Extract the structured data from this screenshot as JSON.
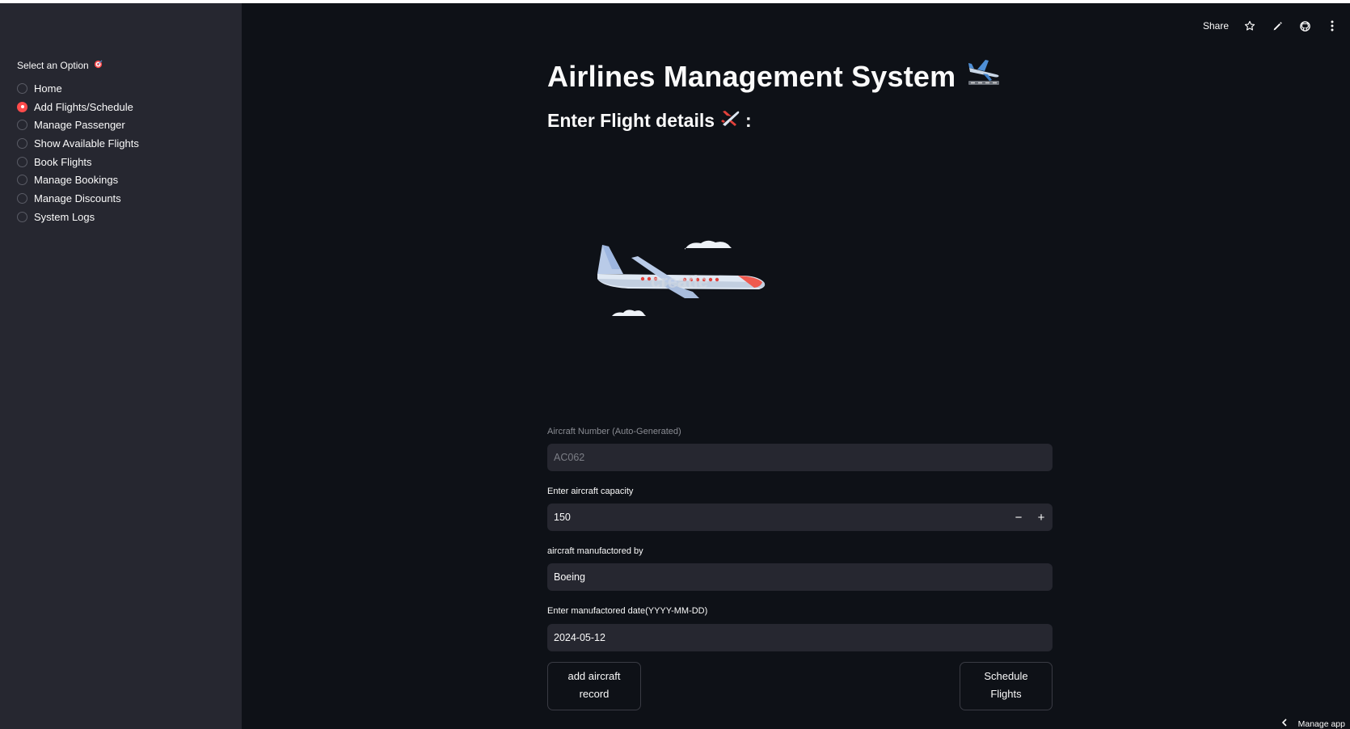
{
  "sidebar": {
    "label": "Select an Option",
    "label_icon": "target-icon",
    "options": [
      {
        "label": "Home",
        "selected": false
      },
      {
        "label": "Add Flights/Schedule",
        "selected": true
      },
      {
        "label": "Manage Passenger",
        "selected": false
      },
      {
        "label": "Show Available Flights",
        "selected": false
      },
      {
        "label": "Book Flights",
        "selected": false
      },
      {
        "label": "Manage Bookings",
        "selected": false
      },
      {
        "label": "Manage Discounts",
        "selected": false
      },
      {
        "label": "System Logs",
        "selected": false
      }
    ]
  },
  "toolbar": {
    "share_label": "Share",
    "icons": [
      "star-icon",
      "pencil-icon",
      "github-icon",
      "more-vertical-icon"
    ]
  },
  "main": {
    "title": "Airlines Management System",
    "title_icon": "airplane-emoji-icon",
    "subtitle": "Enter Flight details",
    "subtitle_icon": "airplane-small-emoji-icon",
    "subtitle_suffix": ":",
    "illustration_icon": "airplane-illustration-icon"
  },
  "form": {
    "aircraft_number_label": "Aircraft Number (Auto-Generated)",
    "aircraft_number_value": "AC062",
    "capacity_label": "Enter aircraft capacity",
    "capacity_value": "150",
    "stepper_minus": "−",
    "stepper_plus": "+",
    "manufacturer_label": "aircraft manufactored by",
    "manufacturer_value": "Boeing",
    "date_label": "Enter manufactored date(YYYY-MM-DD)",
    "date_value": "2024-05-12",
    "add_button_line1": "add aircraft",
    "add_button_line2": "record",
    "schedule_button_line1": "Schedule",
    "schedule_button_line2": "Flights"
  },
  "footer": {
    "manage_app_label": "Manage app"
  },
  "colors": {
    "background": "#0e1117",
    "sidebar": "#262730",
    "accent": "#ff4b4b",
    "input_bg": "#262730"
  }
}
